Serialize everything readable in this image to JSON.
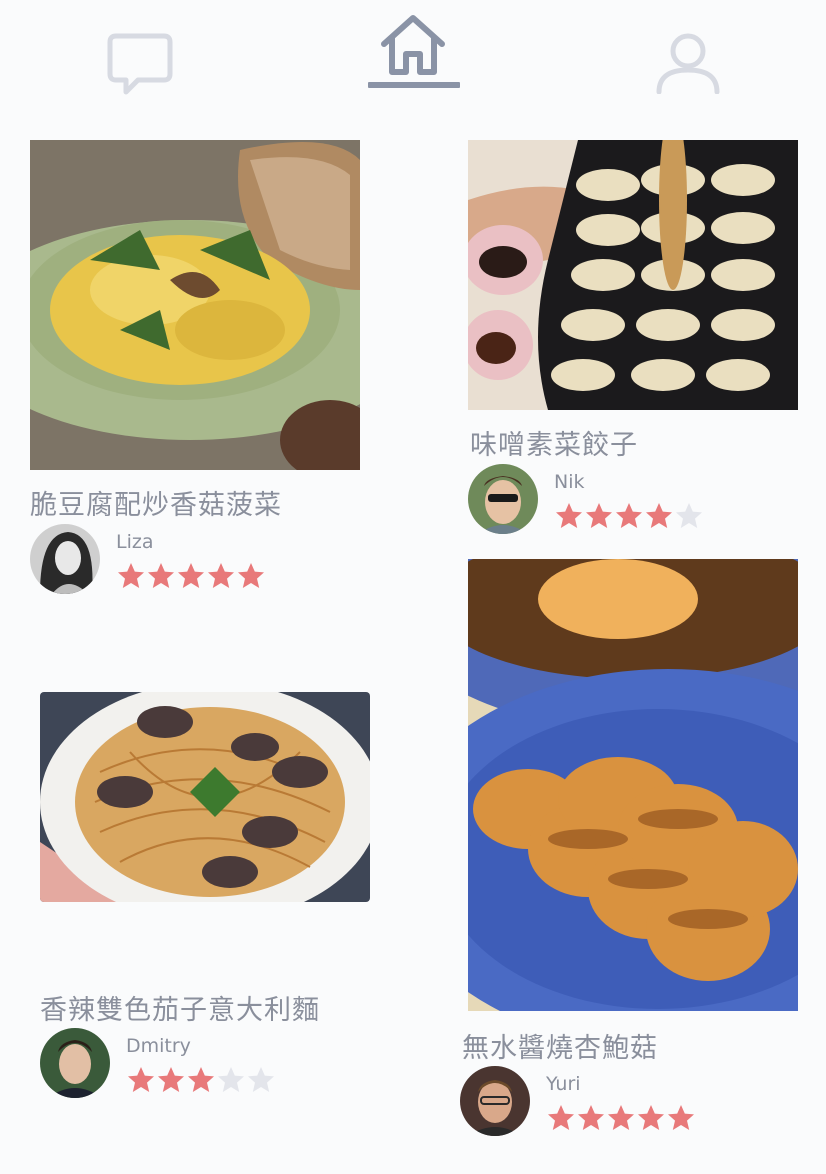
{
  "nav": {
    "items": [
      {
        "icon": "chat-bubble-icon"
      },
      {
        "icon": "home-icon",
        "active": true
      },
      {
        "icon": "user-icon"
      }
    ],
    "active_color": "#8a93a6",
    "inactive_color": "#d7dae2"
  },
  "recipes": [
    {
      "title": "脆豆腐配炒香菇菠菜",
      "author": "Liza",
      "rating": 5
    },
    {
      "title": "味噌素菜餃子",
      "author": "Nik",
      "rating": 4
    },
    {
      "title": "香辣雙色茄子意大利麵",
      "author": "Dmitry",
      "rating": 3
    },
    {
      "title": "無水醬燒杏鮑菇",
      "author": "Yuri",
      "rating": 5
    }
  ],
  "rating_max": 5,
  "colors": {
    "star_filled": "#e8797a",
    "star_empty": "#e3e5eb",
    "text": "#8a8f9c"
  }
}
